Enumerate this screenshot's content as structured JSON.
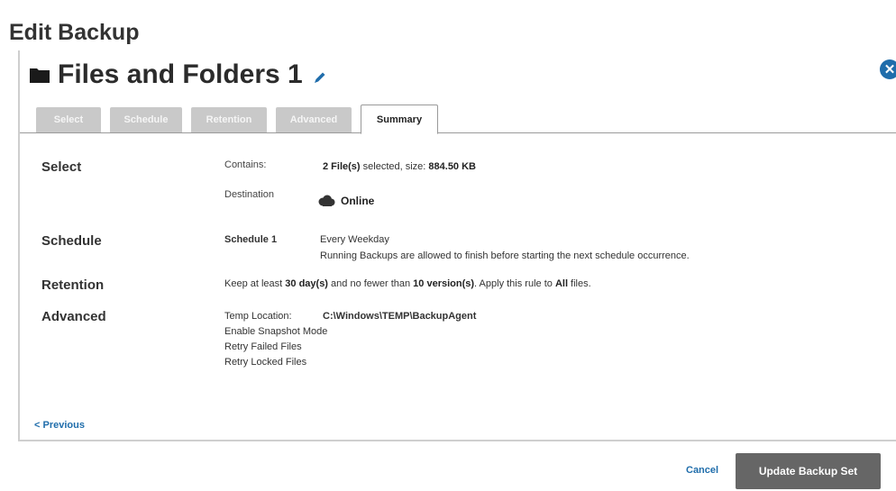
{
  "page": {
    "title": "Edit Backup"
  },
  "backup": {
    "name": "Files and Folders 1"
  },
  "tabs": [
    {
      "label": "Select"
    },
    {
      "label": "Schedule"
    },
    {
      "label": "Retention"
    },
    {
      "label": "Advanced"
    },
    {
      "label": "Summary",
      "active": true
    }
  ],
  "summary": {
    "select": {
      "heading": "Select",
      "contains_label": "Contains:",
      "contains_count": "2 File(s)",
      "contains_mid": " selected, size: ",
      "contains_size": "884.50 KB",
      "destination_label": "Destination",
      "destination_value": "Online"
    },
    "schedule": {
      "heading": "Schedule",
      "name": "Schedule 1",
      "frequency": "Every Weekday",
      "note": "Running Backups are allowed to finish before starting the next schedule occurrence."
    },
    "retention": {
      "heading": "Retention",
      "t1": "Keep at least ",
      "days": "30 day(s)",
      "t2": " and no fewer than ",
      "versions": "10 version(s)",
      "t3": ". Apply this rule to ",
      "scope": "All",
      "t4": " files."
    },
    "advanced": {
      "heading": "Advanced",
      "temp_label": "Temp Location:",
      "temp_value": "C:\\Windows\\TEMP\\BackupAgent",
      "options": [
        "Enable Snapshot Mode",
        "Retry Failed Files",
        "Retry Locked Files"
      ]
    }
  },
  "footer": {
    "previous_label": "< Previous",
    "cancel_label": "Cancel",
    "update_label": "Update Backup Set"
  },
  "icons": {
    "folder": "folder-icon",
    "edit": "pencil-icon",
    "close": "close-icon",
    "cloud": "cloud-icon"
  },
  "colors": {
    "accent": "#1f6dab",
    "primary_button": "#666666",
    "inactive_tab": "#c9c9c9"
  }
}
